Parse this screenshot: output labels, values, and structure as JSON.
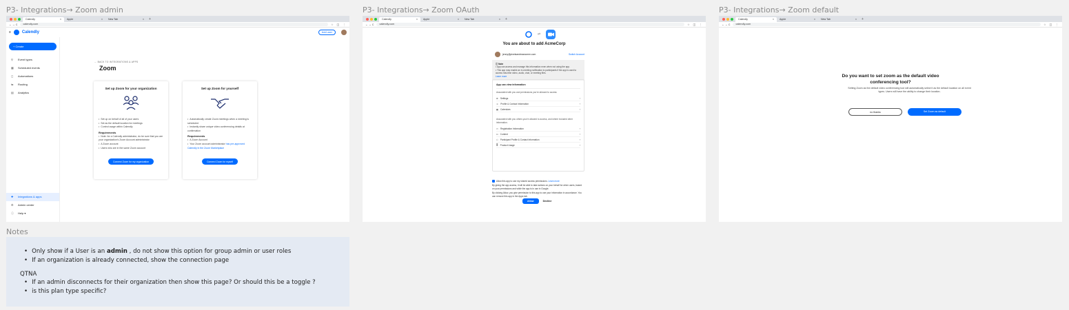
{
  "frames": [
    {
      "title": "P3- Integrations→ Zoom admin"
    },
    {
      "title": "P3- Integrations→ Zoom OAuth"
    },
    {
      "title": "P3- Integrations→ Zoom default"
    }
  ],
  "browser": {
    "tabs": [
      "Calendly",
      "Apple",
      "New Tab"
    ],
    "url": "calendly.com",
    "close": "×",
    "plus": "+"
  },
  "colors": {
    "accent": "#006bff",
    "zoom": "#2d8cff",
    "notes_bg": "#e4eaf3"
  },
  "admin": {
    "logo": "Calendly",
    "add_user": "Add user",
    "create": "+  Create",
    "sidebar": [
      "Event types",
      "Scheduled events",
      "Automations",
      "Routing",
      "Analytics"
    ],
    "sidebar_bottom": [
      "Integrations & apps",
      "Admin center",
      "Help  ▾"
    ],
    "back": "←  BACK TO INTEGRATIONS & APPS",
    "title": "Zoom",
    "card1": {
      "title": "Set up Zoom for your organization",
      "bullets": [
        "Set up on behalf of all of your users",
        "Set as the default location for meetings",
        "Control usage within Calendly"
      ],
      "req_label": "Requirements",
      "req": [
        "Note: for a Calendly administrator, do be sure that you are your organization's Zoom Account administrator",
        "A Zoom account",
        "Users who are in the same Zoom account"
      ],
      "button": "Connect Zoom for my organization"
    },
    "card2": {
      "title": "Set up Zoom for yourself",
      "bullets": [
        "Automatically create Zoom meetings when a meeting is scheduled",
        "Instantly share unique video conferencing details at confirmation"
      ],
      "req_label": "Requirements",
      "req": [
        "A Zoom Account",
        "Your Zoom account administrator "
      ],
      "req_link": "has pre-approved Calendly in the Zoom Marketplace",
      "button": "Connect Zoom for myself"
    }
  },
  "oauth": {
    "title": "You are about to add AcmeCorp",
    "email": "jenny@pixelsandmarcomm.com",
    "switch": "Switch Account",
    "note_title": "Note",
    "note_lines": [
      "App can access and manage this information even when not using the app.",
      "This app may enable an in-meeting notification to participants if the app is used to access real-time video, audio, chat, or meeting files."
    ],
    "learn_more": "Learn more",
    "perm_head": "App can view information",
    "perm_sub1": "Associated with you and permissions you're allowed to access",
    "perms1": [
      "Settings",
      "Profile & Contact Information",
      "Calendars"
    ],
    "perm_sub2": "Associated with you others you're allowed to access, and where included other information.",
    "perms2": [
      "Registration Information",
      "Content",
      "Participant Profile & Contact Information",
      "Product Usage"
    ],
    "allow_text": "Allow this app to use my shared access permissions.",
    "allow_link": "Learn more",
    "legal1": "By giving the app access, it will be able to take actions on your behalf for when users, based on your permissions and while the app is in use in Google.",
    "legal2": "By clicking Allow, you give permission to this app to use your information in accordance. You can remove this app in the Apps tab.",
    "allow": "Allow",
    "decline": "Decline",
    "chev": "›"
  },
  "default": {
    "title_line1": "Do you want to set zoom as the default video",
    "title_line2": "conferencing tool?",
    "desc": "Setting Zoom as the default video conferencing tool will automatically select it as the default location on all event types. Users will have the ability to change their location.",
    "no_thanks": "no thanks",
    "set_default": "Set Zoom as default"
  },
  "notes": {
    "title": "Notes",
    "bullet1_pre": "Only show if a User is an ",
    "bullet1_bold": "admin",
    "bullet1_post": " , do not show this option for group admin or user roles",
    "bullet2": "If an organization is already connected, show the connection page",
    "qtna": "QTNA",
    "q1": "If an admin disconnects for their organization then show this page? Or should this be a toggle ?",
    "q2": "is this plan type specific?"
  }
}
